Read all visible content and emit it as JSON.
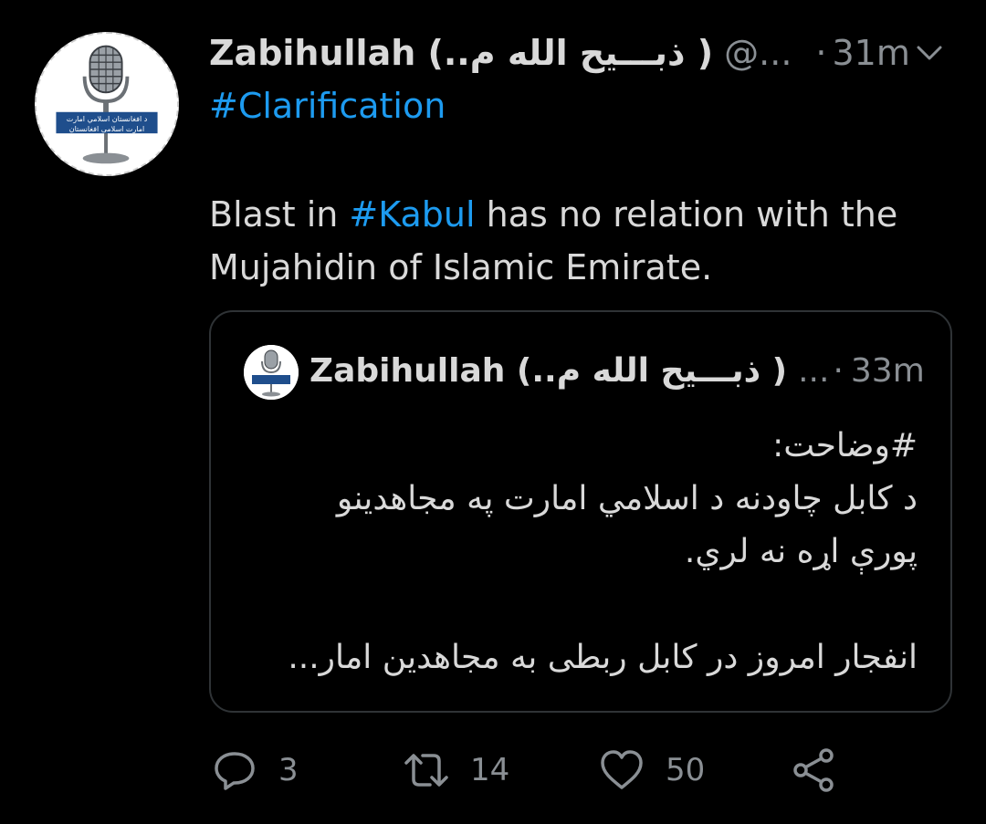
{
  "tweet": {
    "display_name": "Zabihullah (..ذبـــيح الله م )",
    "handle": "@...",
    "dot": "·",
    "time": "31m",
    "line1_hashtag": "#Clarification",
    "line2_prefix": "Blast in ",
    "line2_hashtag": "#Kabul",
    "line2_suffix": " has no relation with the",
    "line3": "Mujahidin of Islamic Emirate.",
    "avatar_icon": "microphone-icon",
    "avatar_banner_line1": "د افغانستان اسلامي امارت",
    "avatar_banner_line2": "امارت اسلامی افغانستان"
  },
  "quote": {
    "display_name": "Zabihullah (..ذبـــيح الله م )",
    "handle": "...",
    "dot": "·",
    "time": "33m",
    "lines": [
      "#وضاحت:",
      "د کابل چاودنه د اسلامي امارت په مجاهدينو",
      "پورې اړه نه لري.",
      "",
      "انفجار امروز در کابل ربطی به مجاهدین امار..."
    ]
  },
  "actions": {
    "reply": {
      "icon": "reply-icon",
      "count": "3"
    },
    "retweet": {
      "icon": "retweet-icon",
      "count": "14"
    },
    "like": {
      "icon": "heart-icon",
      "count": "50"
    },
    "share": {
      "icon": "share-icon"
    }
  },
  "colors": {
    "background": "#000000",
    "text": "#d9d9d9",
    "secondary": "#8a8f94",
    "accent": "#1d9bf0",
    "border": "#2f3336"
  }
}
